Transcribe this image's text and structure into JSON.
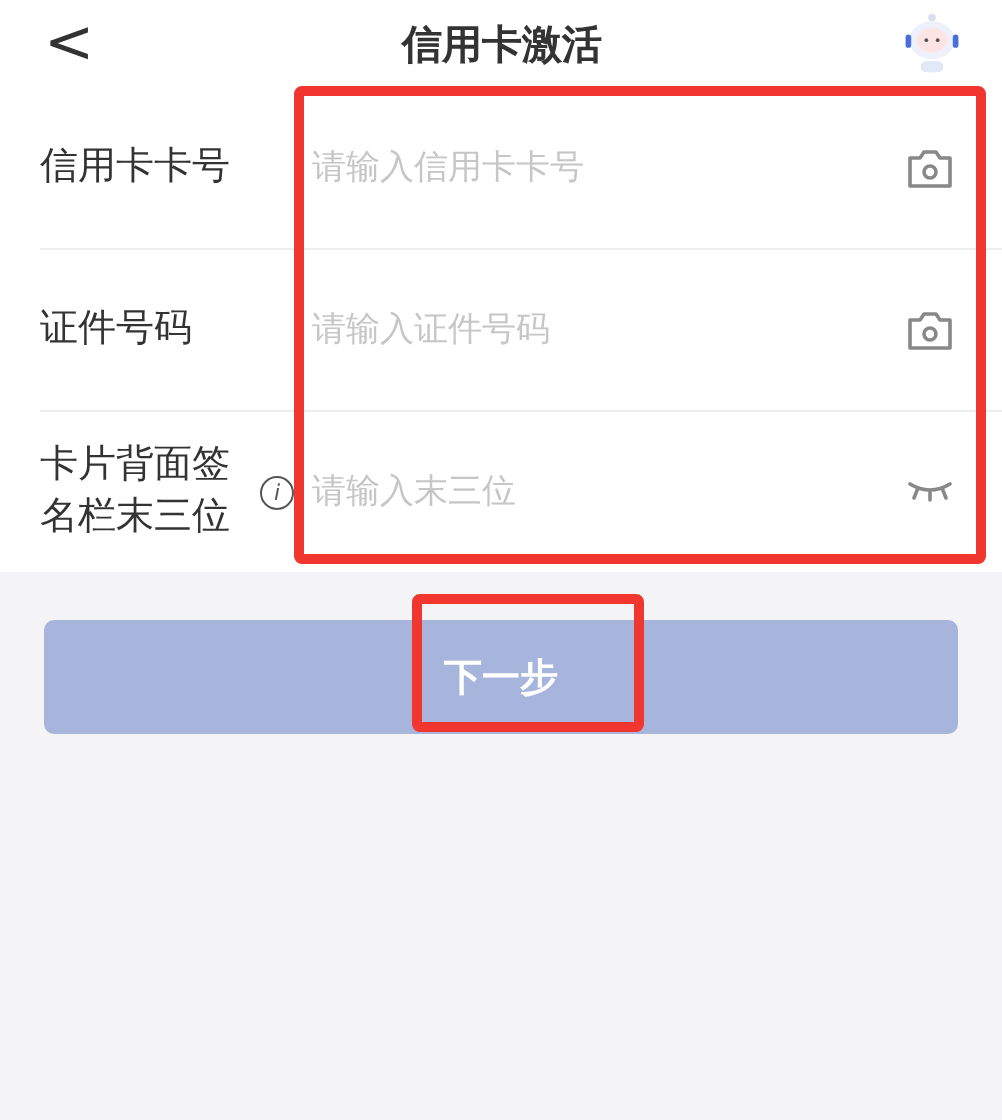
{
  "header": {
    "back": "<",
    "title": "信用卡激活"
  },
  "fields": [
    {
      "label": "信用卡卡号",
      "info": false,
      "placeholder": "请输入信用卡卡号",
      "kind": "camera"
    },
    {
      "label": "证件号码",
      "info": false,
      "placeholder": "请输入证件号码",
      "kind": "camera"
    },
    {
      "label": "卡片背面签名栏末三位",
      "info": true,
      "info_text": "i",
      "placeholder": "请输入末三位",
      "kind": "hidden"
    }
  ],
  "next_button": {
    "label": "下一步",
    "disabled": true
  }
}
